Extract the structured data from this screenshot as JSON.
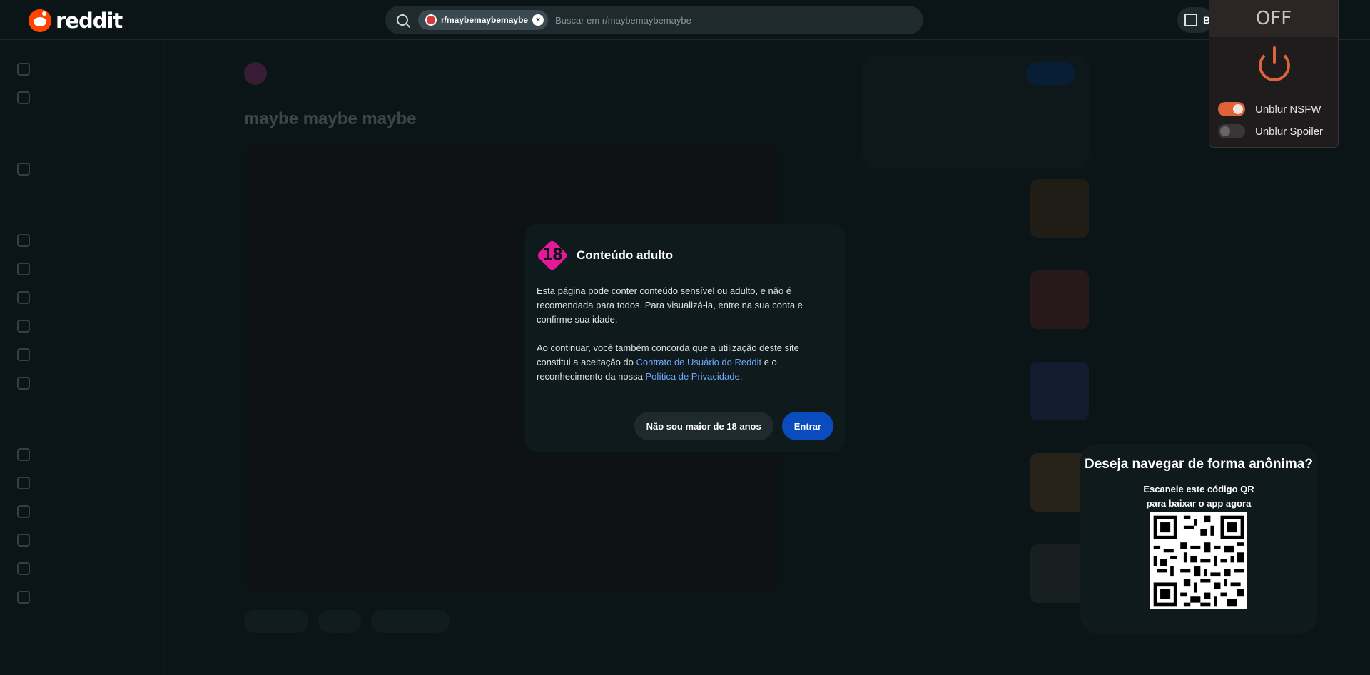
{
  "topbar": {
    "logo_text": "reddit",
    "search": {
      "chip_label": "r/maybemaybemaybe",
      "placeholder": "Buscar em r/maybemaybemaybe"
    },
    "qr_button_label": "B"
  },
  "modal": {
    "badge": "18",
    "title": "Conteúdo adulto",
    "para1": "Esta página pode conter conteúdo sensível ou adulto, e não é recomendada para todos. Para visualizá-la, entre na sua conta e confirme sua idade.",
    "para2_prefix": "Ao continuar, você também concorda que a utilização deste site constitui a aceitação do ",
    "link_terms": "Contrato de Usuário do Reddit",
    "para2_mid": " e o reconhecimento da nossa ",
    "link_privacy": "Política de Privacidade",
    "para2_suffix": ".",
    "btn_decline": "Não sou maior de 18 anos",
    "btn_login": "Entrar"
  },
  "extension": {
    "status": "OFF",
    "toggles": [
      {
        "label": "Unblur NSFW",
        "on": true
      },
      {
        "label": "Unblur Spoiler",
        "on": false
      }
    ],
    "accent": "#e0623a"
  },
  "qr_card": {
    "title": "Deseja navegar de forma anônima?",
    "subtitle_line1": "Escaneie este código QR",
    "subtitle_line2": "para baixar o app agora"
  },
  "background_page": {
    "post_title": "maybe maybe maybe"
  },
  "colors": {
    "brand": "#ff4500",
    "nsfw_badge": "#e3199a",
    "primary_button": "#0a4bbd",
    "link": "#6ea8ff"
  }
}
